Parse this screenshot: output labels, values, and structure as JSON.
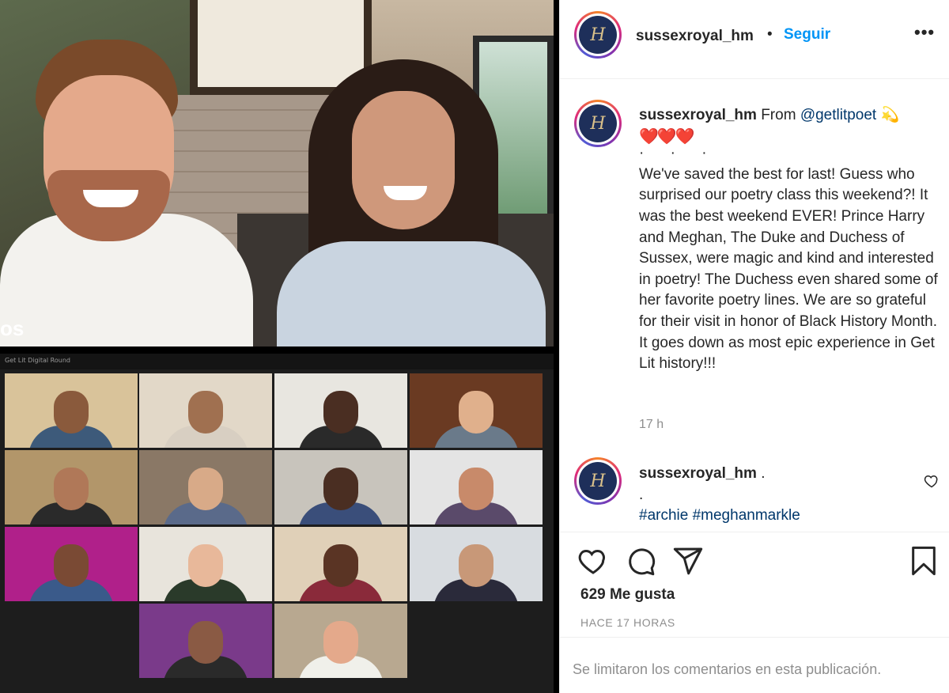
{
  "post": {
    "username": "sussexroyal_hm",
    "follow_label": "Seguir",
    "separator": "•",
    "more_icon": "more-options-icon",
    "avatar_monogram": "H"
  },
  "media": {
    "corner_label": "os",
    "zoom_title": "Get Lit Digital Round"
  },
  "caption": {
    "username": "sussexroyal_hm",
    "intro": "From",
    "mention": "@getlitpoet",
    "star_emoji": "💫",
    "hearts": "❤️❤️❤️",
    "dots": "· · ·",
    "body": "We've saved the best for last! Guess who surprised our poetry class this weekend?! It was the best weekend EVER! Prince Harry and Meghan, The Duke and Duchess of Sussex, were magic and kind and interested in poetry! The Duchess even shared some of her favorite poetry lines. We are so grateful for their visit in honor of Black History Month. It goes down as most epic experience in Get Lit history!!!",
    "time": "17 h"
  },
  "comment": {
    "username": "sussexroyal_hm",
    "text": ".",
    "line2": ".",
    "hashtags": "#archie #meghanmarkle"
  },
  "actions": {
    "like_icon": "heart-icon",
    "comment_icon": "comment-icon",
    "share_icon": "share-icon",
    "save_icon": "bookmark-icon",
    "likes": "629 Me gusta",
    "ago": "HACE 17 HORAS",
    "comments_disabled": "Se limitaron los comentarios en esta publicación."
  }
}
